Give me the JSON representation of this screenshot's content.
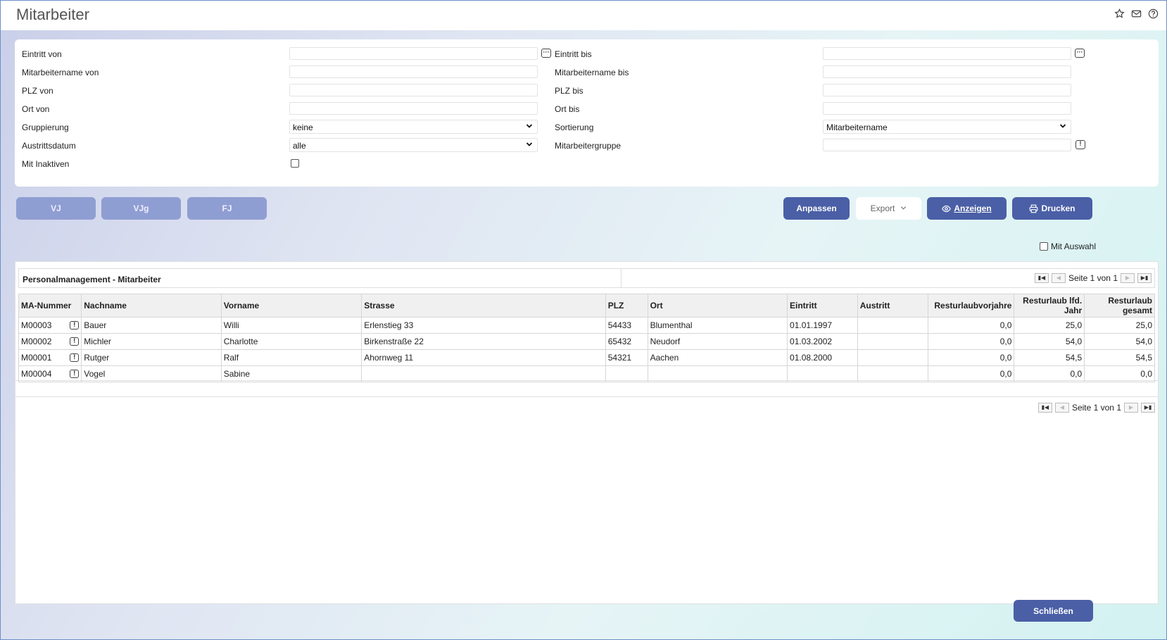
{
  "window": {
    "title": "Mitarbeiter"
  },
  "filters": {
    "eintritt_von": "Eintritt von",
    "eintritt_bis": "Eintritt bis",
    "name_von": "Mitarbeitername von",
    "name_bis": "Mitarbeitername bis",
    "plz_von": "PLZ von",
    "plz_bis": "PLZ bis",
    "ort_von": "Ort von",
    "ort_bis": "Ort bis",
    "gruppierung": "Gruppierung",
    "gruppierung_value": "keine",
    "sortierung": "Sortierung",
    "sortierung_value": "Mitarbeitername",
    "austrittsdatum": "Austrittsdatum",
    "austrittsdatum_value": "alle",
    "mitarbeitergruppe": "Mitarbeitergruppe",
    "mit_inaktiven": "Mit Inaktiven"
  },
  "buttons": {
    "vj": "VJ",
    "vjg": "VJg",
    "fj": "FJ",
    "anpassen": "Anpassen",
    "export": "Export",
    "anzeigen": "Anzeigen",
    "drucken": "Drucken",
    "schliessen": "Schließen"
  },
  "mit_auswahl": "Mit Auswahl",
  "report": {
    "title": "Personalmanagement - Mitarbeiter",
    "page_text": "Seite 1 von 1",
    "columns": [
      "MA-Nummer",
      "Nachname",
      "Vorname",
      "Strasse",
      "PLZ",
      "Ort",
      "Eintritt",
      "Austritt",
      "Resturlaubvorjahre",
      "Resturlaub lfd. Jahr",
      "Resturlaub gesamt"
    ],
    "rows": [
      [
        "M00003",
        "Bauer",
        "Willi",
        "Erlenstieg 33",
        "54433",
        "Blumenthal",
        "01.01.1997",
        "",
        "0,0",
        "25,0",
        "25,0"
      ],
      [
        "M00002",
        "Michler",
        "Charlotte",
        "Birkenstraße 22",
        "65432",
        "Neudorf",
        "01.03.2002",
        "",
        "0,0",
        "54,0",
        "54,0"
      ],
      [
        "M00001",
        "Rutger",
        "Ralf",
        "Ahornweg 11",
        "54321",
        "Aachen",
        "01.08.2000",
        "",
        "0,0",
        "54,5",
        "54,5"
      ],
      [
        "M00004",
        "Vogel",
        "Sabine",
        "",
        "",
        "",
        "",
        "",
        "0,0",
        "0,0",
        "0,0"
      ]
    ]
  },
  "icons": {
    "star": "star-icon",
    "mail": "mail-icon",
    "help": "help-icon",
    "browse": "ellipsis-icon",
    "info": "exclamation-icon",
    "eye": "eye-icon",
    "printer": "printer-icon"
  }
}
